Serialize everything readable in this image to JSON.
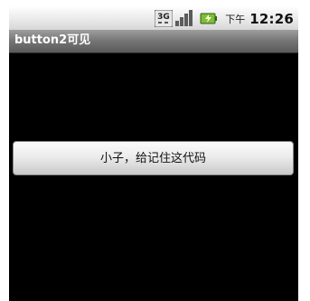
{
  "status_bar": {
    "network_badge": "3G",
    "time_period": "下午",
    "time": "12:26",
    "icons": [
      "3g-network-icon",
      "signal-strength-icon",
      "battery-charging-icon"
    ]
  },
  "title_bar": {
    "title": "button2可见"
  },
  "main": {
    "button_label": "小子，给记住这代码"
  },
  "colors": {
    "screen_background": "#000000",
    "title_bar": "#747474",
    "status_bar": "#e9e9e9",
    "battery_green": "#7fbe35"
  }
}
